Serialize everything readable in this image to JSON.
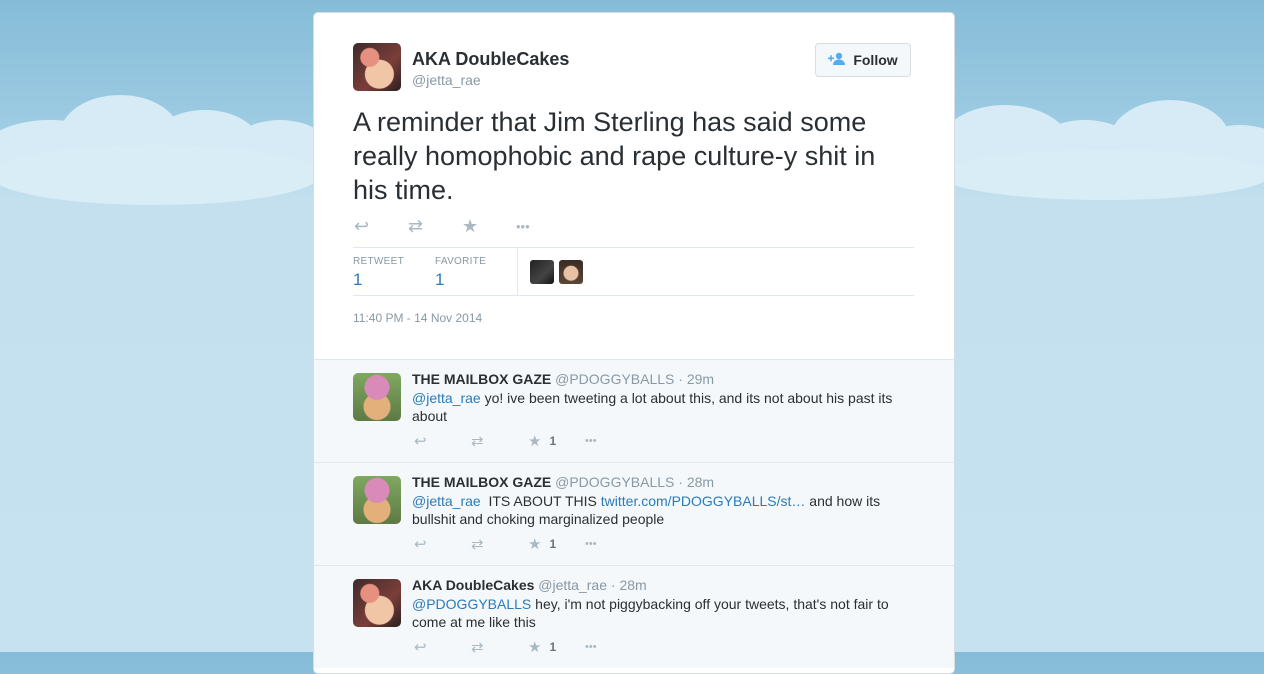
{
  "tweet": {
    "author_name": "AKA DoubleCakes",
    "author_handle": "@jetta_rae",
    "follow_label": "Follow",
    "follow_icon": "add-user-icon",
    "text": "A reminder that Jim Sterling has said some really homophobic and rape culture-y shit in his time.",
    "actions": {
      "reply": "↩",
      "retweet": "⇄",
      "favorite": "★",
      "more": "•••"
    },
    "stats": {
      "retweet_label": "RETWEET",
      "retweet_count": "1",
      "favorite_label": "FAVORITE",
      "favorite_count": "1"
    },
    "timestamp": "11:40 PM - 14 Nov 2014"
  },
  "replies": [
    {
      "name": "THE MAILBOX GAZE",
      "handle": "@PDOGGYBALLS",
      "time": "· 29m",
      "mention": "@jetta_rae",
      "text": " yo! ive been tweeting a lot about this, and its not about his past its about",
      "link": "",
      "text_after": "",
      "fav_count": "1"
    },
    {
      "name": "THE MAILBOX GAZE",
      "handle": "@PDOGGYBALLS",
      "time": "· 28m",
      "mention": "@jetta_rae",
      "text": "  ITS ABOUT THIS ",
      "link": "twitter.com/PDOGGYBALLS/st…",
      "text_after": " and how its bullshit and choking marginalized people",
      "fav_count": "1"
    },
    {
      "name": "AKA DoubleCakes",
      "handle": "@jetta_rae",
      "time": "· 28m",
      "mention": "@PDOGGYBALLS",
      "text": " hey, i'm not piggybacking off your tweets, that's not fair to come at me like this",
      "link": "",
      "text_after": "",
      "fav_count": "1"
    }
  ],
  "colors": {
    "link": "#2b7bb9",
    "accent": "#55acee",
    "muted": "#8899a6",
    "background": "#c6e2f0"
  }
}
